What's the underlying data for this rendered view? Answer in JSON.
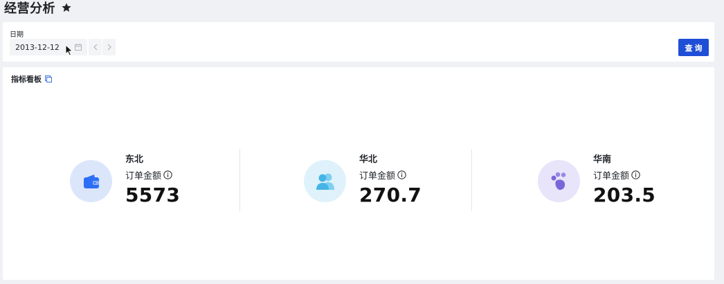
{
  "header": {
    "title": "经营分析",
    "icon": "star-icon"
  },
  "filter": {
    "date_label": "日期",
    "date_value": "2013-12-12",
    "query_label": "查询"
  },
  "board": {
    "title": "指标看板",
    "metrics": [
      {
        "region": "东北",
        "label": "订单金额",
        "value": "5573",
        "icon": "wallet-icon",
        "color": "#2c6ff6",
        "bg": "#dce6fb"
      },
      {
        "region": "华北",
        "label": "订单金额",
        "value": "270.7",
        "icon": "users-icon",
        "color": "#44b5e6",
        "bg": "#dff1fb"
      },
      {
        "region": "华南",
        "label": "订单金额",
        "value": "203.5",
        "icon": "paw-icon",
        "color": "#7b66d9",
        "bg": "#e8e4fa"
      }
    ]
  },
  "colors": {
    "primary": "#1f4fd6",
    "background": "#eff1f4"
  }
}
